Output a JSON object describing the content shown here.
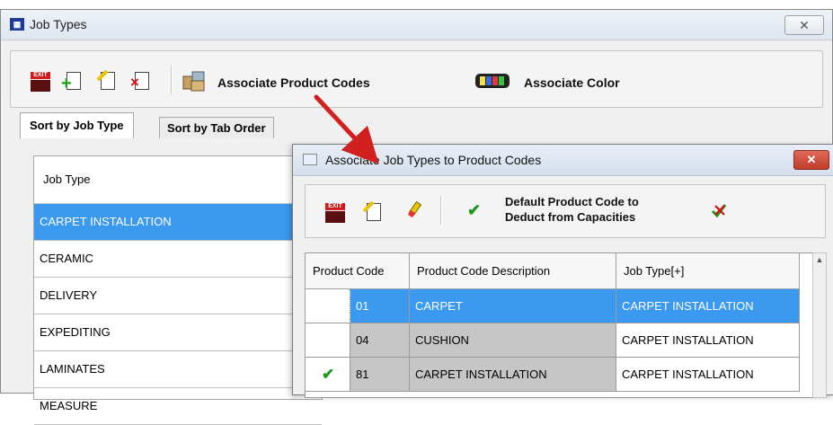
{
  "main_window": {
    "app_icon_text": "▦",
    "title": "Job Types",
    "close_label": "✕"
  },
  "toolbar": {
    "exit_label": "EXIT",
    "associate_product_codes": "Associate Product Codes",
    "associate_color": "Associate Color"
  },
  "tabs": [
    {
      "label": "Sort by Job Type"
    },
    {
      "label": "Sort by Tab Order"
    }
  ],
  "job_list": {
    "header": "Job Type",
    "rows": [
      "CARPET INSTALLATION",
      "CERAMIC",
      "DELIVERY",
      "EXPEDITING",
      "LAMINATES",
      "MEASURE"
    ]
  },
  "dialog": {
    "title": "Associate Job Types to Product Codes",
    "close_label": "✕",
    "exit_label": "EXIT",
    "default_line1": "Default Product Code to",
    "default_line2": "Deduct from Capacities",
    "check_glyph": "✔",
    "grid": {
      "columns": [
        "Product Code",
        "Product Code Description",
        "Job Type[+]"
      ],
      "rows": [
        {
          "check": "",
          "code": "01",
          "description": "CARPET",
          "job_type": "CARPET INSTALLATION"
        },
        {
          "check": "",
          "code": "04",
          "description": "CUSHION",
          "job_type": "CARPET INSTALLATION"
        },
        {
          "check": "✔",
          "code": "81",
          "description": "CARPET INSTALLATION",
          "job_type": "CARPET INSTALLATION"
        }
      ]
    },
    "scroll_up": "▲"
  },
  "colors": {
    "selection": "#3b99f0",
    "arrow": "#d22020",
    "check_green": "#1a9a1a"
  }
}
